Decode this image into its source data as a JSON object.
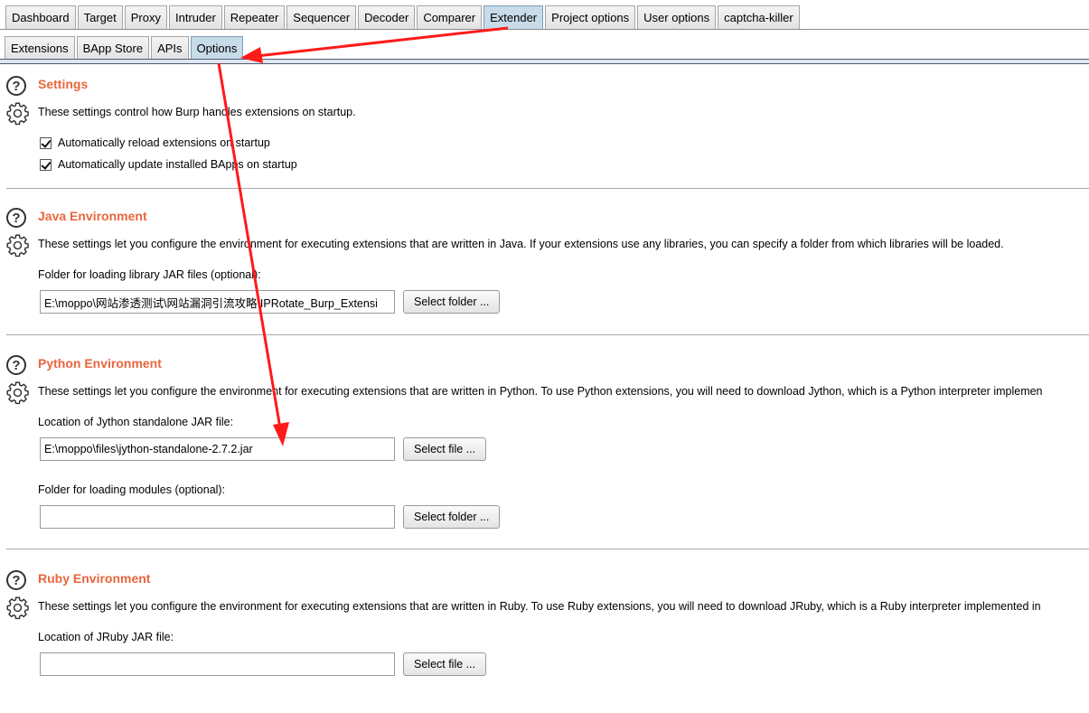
{
  "top_tabs": [
    "Dashboard",
    "Target",
    "Proxy",
    "Intruder",
    "Repeater",
    "Sequencer",
    "Decoder",
    "Comparer",
    "Extender",
    "Project options",
    "User options",
    "captcha-killer"
  ],
  "top_active": "Extender",
  "sub_tabs": [
    "Extensions",
    "BApp Store",
    "APIs",
    "Options"
  ],
  "sub_active": "Options",
  "settings": {
    "title": "Settings",
    "description": "These settings control how Burp handles extensions on startup.",
    "checkboxes": [
      {
        "label": "Automatically reload extensions on startup",
        "checked": true
      },
      {
        "label": "Automatically update installed BApps on startup",
        "checked": true
      }
    ]
  },
  "java": {
    "title": "Java Environment",
    "description": "These settings let you configure the environment for executing extensions that are written in Java. If your extensions use any libraries, you can specify a folder from which libraries will be loaded.",
    "folder_label": "Folder for loading library JAR files (optional):",
    "folder_value": "E:\\moppo\\网站渗透测试\\网站漏洞引流攻略\\IPRotate_Burp_Extensi",
    "select_folder": "Select folder ..."
  },
  "python": {
    "title": "Python Environment",
    "description": "These settings let you configure the environment for executing extensions that are written in Python. To use Python extensions, you will need to download Jython, which is a Python interpreter implemen",
    "jar_label": "Location of Jython standalone JAR file:",
    "jar_value": "E:\\moppo\\files\\jython-standalone-2.7.2.jar",
    "select_file": "Select file ...",
    "modules_label": "Folder for loading modules (optional):",
    "modules_value": "",
    "select_folder": "Select folder ..."
  },
  "ruby": {
    "title": "Ruby Environment",
    "description": "These settings let you configure the environment for executing extensions that are written in Ruby. To use Ruby extensions, you will need to download JRuby, which is a Ruby interpreter implemented in",
    "jar_label": "Location of JRuby JAR file:",
    "jar_value": "",
    "select_file": "Select file ..."
  },
  "colors": {
    "section_title": "#e8663c",
    "active_tab": "#c7dbe9",
    "annotation_arrow": "#ff1a1a"
  }
}
